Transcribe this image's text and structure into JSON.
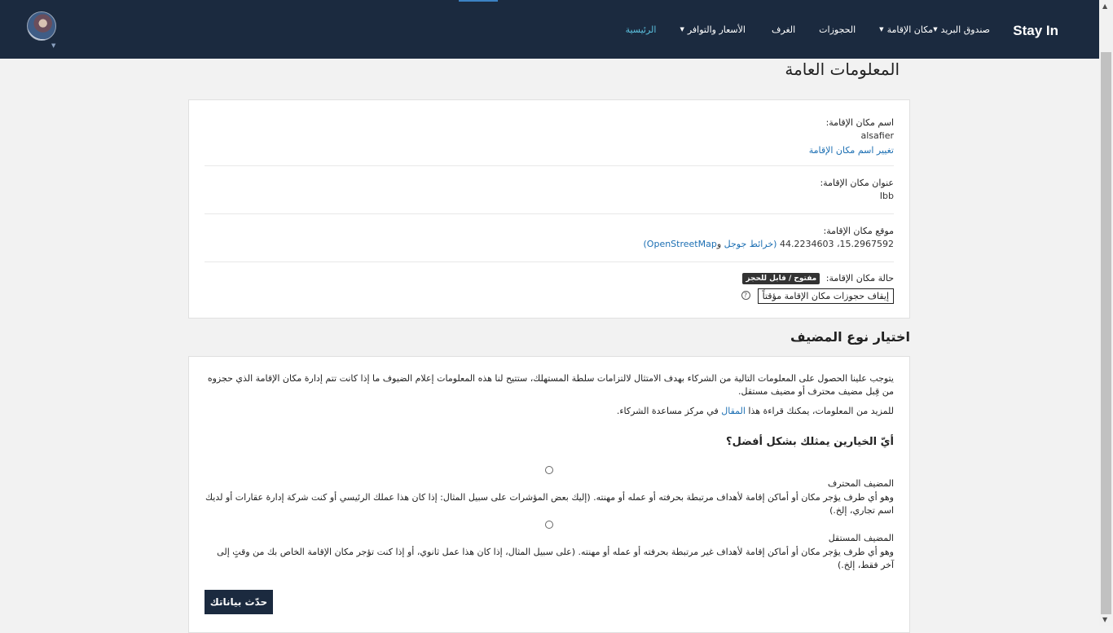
{
  "header": {
    "brand": "Stay In",
    "nav": [
      {
        "label": "الرئيسية",
        "active": true,
        "dropdown": false
      },
      {
        "label": "الأسعار والتوافر",
        "active": false,
        "dropdown": true
      },
      {
        "label": "الغرف",
        "active": false,
        "dropdown": false
      },
      {
        "label": "الحجوزات",
        "active": false,
        "dropdown": false
      },
      {
        "label": "مكان الإقامة",
        "active": false,
        "dropdown": true
      },
      {
        "label": "صندوق البريد",
        "active": false,
        "dropdown": true
      }
    ],
    "caret": "▼",
    "avatar_icon": "user-avatar"
  },
  "general": {
    "title": "المعلومات العامة",
    "name_label": "اسم مكان الإقامة:",
    "name_value": "alsafier",
    "name_change_link": "تغيير اسم مكان الإقامة",
    "address_label": "عنوان مكان الإقامة:",
    "address_value": "Ibb",
    "location_label": "موقع مكان الإقامة:",
    "location_coords": "15.2967592، 44.2234603",
    "location_google": "(خرائط جوجل",
    "location_and": " و",
    "location_osm": "OpenStreetMap)",
    "status_label": "حالة مكان الإقامة:",
    "status_badge": "مفتوح / قابل للحجز",
    "pause_button": "إيقاف حجوزات مكان الإقامة مؤقتاً",
    "help_icon": "?"
  },
  "host_type": {
    "title": "اختيار نوع المضيف",
    "intro": "يتوجب علينا الحصول على المعلومات التالية من الشركاء بهدف الامتثال لالتزامات سلطة المستهلك، ستتيح لنا هذه المعلومات إعلام الضيوف ما إذا كانت تتم إدارة مكان الإقامة الذي حجزوه من قِبل مضيف محترف أو مضيف مستقل.",
    "more_info_before": "للمزيد من المعلومات، يمكنك قراءة هذا ",
    "more_info_link": "المقال",
    "more_info_after": " في مركز مساعدة الشركاء.",
    "question": "أيّ الخيارين يمثلك بشكل أفضل؟",
    "options": [
      {
        "title": "المضيف المحترف",
        "description": "وهو أي طرف يؤجر مكان أو أماكن إقامة لأهداف مرتبطة بحرفته أو عمله أو مهنته. (إليك بعض المؤشرات على سبيل المثال: إذا كان هذا عملك الرئيسي أو كنت شركة إدارة عقارات أو لديك اسم تجاري، إلخ.)",
        "selected": false
      },
      {
        "title": "المضيف المستقل",
        "description": "وهو أي طرف يؤجر مكان أو أماكن إقامة لأهداف غير مرتبطة بحرفته أو عمله أو مهنته. (على سبيل المثال، إذا كان هذا عمل ثانوي، أو إذا كنت تؤجر مكان الإقامة الخاص بك من وقتٍ إلى آخر فقط، إلخ.)",
        "selected": false
      }
    ],
    "update_button": "حدّث بياناتك"
  },
  "colors": {
    "nav_bg": "#1b2a3f",
    "active_nav": "#5bc0de",
    "link": "#1c6fb3"
  }
}
